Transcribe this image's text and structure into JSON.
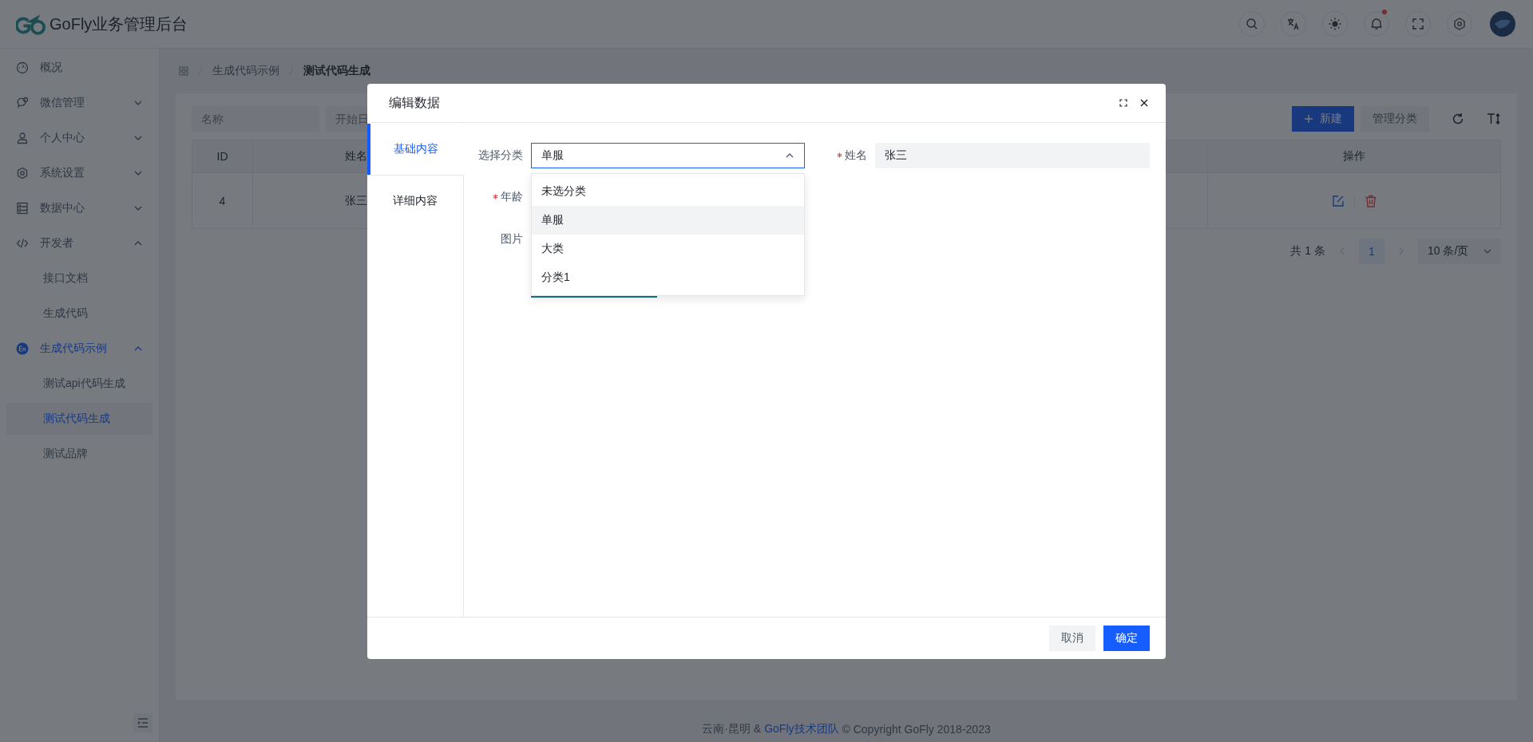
{
  "header": {
    "title": "GoFly业务管理后台",
    "notification_dot": true
  },
  "sidebar": {
    "items": [
      {
        "label": "概况",
        "kind": "link",
        "selected": false
      },
      {
        "label": "微信管理",
        "kind": "group",
        "expanded": false,
        "selected": false
      },
      {
        "label": "个人中心",
        "kind": "group",
        "expanded": false,
        "selected": false
      },
      {
        "label": "系统设置",
        "kind": "group",
        "expanded": false,
        "selected": false
      },
      {
        "label": "数据中心",
        "kind": "group",
        "expanded": false,
        "selected": false
      },
      {
        "label": "开发者",
        "kind": "group",
        "expanded": true,
        "selected": false,
        "children": [
          {
            "label": "接口文档",
            "selected": false
          },
          {
            "label": "生成代码",
            "selected": false
          }
        ]
      },
      {
        "label": "生成代码示例",
        "kind": "group",
        "expanded": true,
        "selected": true,
        "children": [
          {
            "label": "测试api代码生成",
            "selected": false
          },
          {
            "label": "测试代码生成",
            "selected": true
          },
          {
            "label": "测试品牌",
            "selected": false
          }
        ]
      }
    ]
  },
  "breadcrumb": [
    {
      "label": "生成代码示例",
      "current": false
    },
    {
      "label": "测试代码生成",
      "current": true
    }
  ],
  "filters": [
    {
      "placeholder": "名称"
    },
    {
      "placeholder": "开始日"
    }
  ],
  "toolbar": {
    "buttons": [
      {
        "label": "新建",
        "kind": "primary"
      },
      {
        "label": "管理分类",
        "kind": "secondary"
      }
    ]
  },
  "table": {
    "columns": [
      "ID",
      "姓名",
      "操作"
    ],
    "rows": [
      {
        "cells": [
          "4",
          "张三"
        ]
      }
    ]
  },
  "pagination": {
    "total": "共 1 条",
    "pages": [
      {
        "label": "1",
        "selected": true
      }
    ],
    "page_size": "10 条/页"
  },
  "dialog": {
    "title": "编辑数据",
    "tabs": [
      {
        "label": "基础内容",
        "selected": true
      },
      {
        "label": "详细内容",
        "selected": false
      }
    ],
    "category": {
      "label": "选择分类",
      "required": false,
      "value": "单服",
      "open": true,
      "options": [
        {
          "label": "未选分类",
          "selected": false
        },
        {
          "label": "单服",
          "selected": true
        },
        {
          "label": "大类",
          "selected": false
        },
        {
          "label": "分类1",
          "selected": false
        }
      ]
    },
    "name": {
      "label": "姓名",
      "required": true,
      "value": "张三"
    },
    "age": {
      "label": "年龄",
      "required": true
    },
    "image": {
      "label": "图片",
      "required": false
    },
    "buttons": [
      {
        "label": "取消",
        "kind": "secondary"
      },
      {
        "label": "确定",
        "kind": "primary"
      }
    ]
  },
  "footer": {
    "text": "云南·昆明 &",
    "link": "GoFly技术团队",
    "copyright": "© Copyright GoFly 2018-2023"
  }
}
